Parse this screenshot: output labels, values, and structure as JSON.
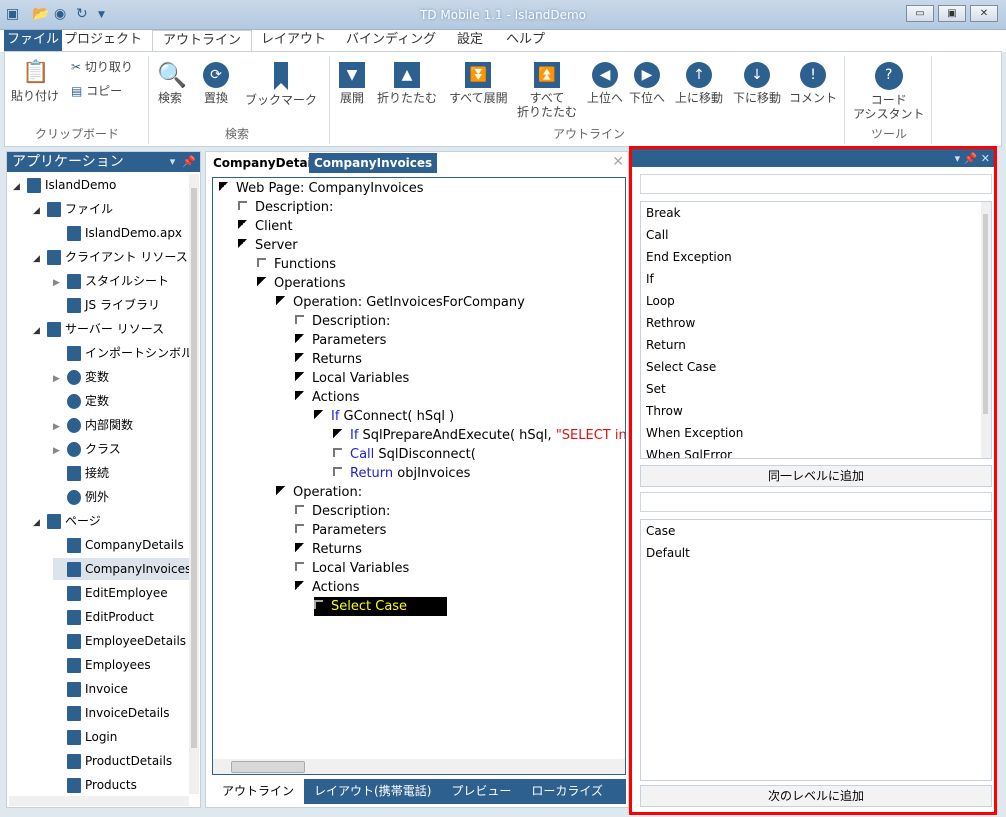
{
  "window": {
    "title": "TD Mobile 1.1 - IslandDemo",
    "minimize": "▭",
    "maximize": "▣",
    "close": "✕"
  },
  "menu_tabs": [
    "ファイル",
    "プロジェクト",
    "アウトライン",
    "レイアウト",
    "バインディング",
    "設定",
    "ヘルプ"
  ],
  "ribbon": {
    "clipboard": {
      "paste": "貼り付け",
      "cut": "切り取り",
      "copy": "コピー",
      "group": "クリップボード"
    },
    "search": {
      "find": "検索",
      "replace": "置換",
      "bookmark": "ブックマーク",
      "group": "検索"
    },
    "outline": {
      "buttons": [
        {
          "label": "展開",
          "icon": "▼"
        },
        {
          "label": "折りたたむ",
          "icon": "▲"
        },
        {
          "label": "すべて展開",
          "icon": "⏬"
        },
        {
          "label": "すべて\n折りたたむ",
          "icon": "⏫"
        },
        {
          "label": "上位へ",
          "icon": "◀"
        },
        {
          "label": "下位へ",
          "icon": "▶"
        },
        {
          "label": "上に移動",
          "icon": "↑"
        },
        {
          "label": "下に移動",
          "icon": "↓"
        },
        {
          "label": "コメント",
          "icon": "!"
        }
      ],
      "group": "アウトライン"
    },
    "tools": {
      "code_assistant": "コード\nアシスタント",
      "group": "ツール"
    }
  },
  "left_panel": {
    "title": "アプリケーション",
    "tree": [
      {
        "label": "IslandDemo",
        "level": 0,
        "exp": "open",
        "icon": "app"
      },
      {
        "label": "ファイル",
        "level": 1,
        "exp": "open",
        "icon": "files"
      },
      {
        "label": "IslandDemo.apx",
        "level": 2,
        "exp": "none",
        "icon": "apx"
      },
      {
        "label": "クライアント リソース",
        "level": 1,
        "exp": "open",
        "icon": "phone"
      },
      {
        "label": "スタイルシート",
        "level": 2,
        "exp": "closed",
        "icon": "css"
      },
      {
        "label": "JS ライブラリ",
        "level": 2,
        "exp": "none",
        "icon": "js"
      },
      {
        "label": "サーバー リソース",
        "level": 1,
        "exp": "open",
        "icon": "server"
      },
      {
        "label": "インポートシンボル",
        "level": 2,
        "exp": "none",
        "icon": "axl"
      },
      {
        "label": "変数",
        "level": 2,
        "exp": "closed",
        "icon": "variable"
      },
      {
        "label": "定数",
        "level": 2,
        "exp": "none",
        "icon": "constant"
      },
      {
        "label": "内部関数",
        "level": 2,
        "exp": "closed",
        "icon": "function"
      },
      {
        "label": "クラス",
        "level": 2,
        "exp": "closed",
        "icon": "gear"
      },
      {
        "label": "接続",
        "level": 2,
        "exp": "none",
        "icon": "connection"
      },
      {
        "label": "例外",
        "level": 2,
        "exp": "none",
        "icon": "exception"
      },
      {
        "label": "ページ",
        "level": 1,
        "exp": "open",
        "icon": "pages"
      },
      {
        "label": "CompanyDetails",
        "level": 2,
        "exp": "none",
        "icon": "page"
      },
      {
        "label": "CompanyInvoices",
        "level": 2,
        "exp": "none",
        "icon": "page",
        "selected": true
      },
      {
        "label": "EditEmployee",
        "level": 2,
        "exp": "none",
        "icon": "page"
      },
      {
        "label": "EditProduct",
        "level": 2,
        "exp": "none",
        "icon": "page"
      },
      {
        "label": "EmployeeDetails",
        "level": 2,
        "exp": "none",
        "icon": "page"
      },
      {
        "label": "Employees",
        "level": 2,
        "exp": "none",
        "icon": "page"
      },
      {
        "label": "Invoice",
        "level": 2,
        "exp": "none",
        "icon": "page"
      },
      {
        "label": "InvoiceDetails",
        "level": 2,
        "exp": "none",
        "icon": "page"
      },
      {
        "label": "Login",
        "level": 2,
        "exp": "none",
        "icon": "page"
      },
      {
        "label": "ProductDetails",
        "level": 2,
        "exp": "none",
        "icon": "page"
      },
      {
        "label": "Products",
        "level": 2,
        "exp": "none",
        "icon": "page"
      }
    ]
  },
  "editor": {
    "tabs": [
      "CompanyDetails",
      "CompanyInvoices"
    ],
    "active_tab": 1,
    "outline": [
      {
        "level": 0,
        "mark": "filled",
        "parts": [
          [
            "Web Page: CompanyInvoices",
            ""
          ]
        ]
      },
      {
        "level": 1,
        "mark": "empty",
        "parts": [
          [
            "Description:",
            ""
          ]
        ]
      },
      {
        "level": 1,
        "mark": "filled",
        "parts": [
          [
            "Client",
            ""
          ]
        ]
      },
      {
        "level": 1,
        "mark": "filled",
        "parts": [
          [
            "Server",
            ""
          ]
        ]
      },
      {
        "level": 2,
        "mark": "empty",
        "parts": [
          [
            "Functions",
            ""
          ]
        ]
      },
      {
        "level": 2,
        "mark": "filled",
        "parts": [
          [
            "Operations",
            ""
          ]
        ]
      },
      {
        "level": 3,
        "mark": "filled",
        "parts": [
          [
            "Operation: GetInvoicesForCompany",
            ""
          ]
        ]
      },
      {
        "level": 4,
        "mark": "empty",
        "parts": [
          [
            "Description:",
            ""
          ]
        ]
      },
      {
        "level": 4,
        "mark": "filled",
        "parts": [
          [
            "Parameters",
            ""
          ]
        ]
      },
      {
        "level": 4,
        "mark": "filled",
        "parts": [
          [
            "Returns",
            ""
          ]
        ]
      },
      {
        "level": 4,
        "mark": "filled",
        "parts": [
          [
            "Local Variables",
            ""
          ]
        ]
      },
      {
        "level": 4,
        "mark": "filled",
        "parts": [
          [
            "Actions",
            ""
          ]
        ]
      },
      {
        "level": 5,
        "mark": "filled",
        "parts": [
          [
            "If ",
            "kw"
          ],
          [
            "GConnect( hSql )",
            ""
          ]
        ]
      },
      {
        "level": 6,
        "mark": "filled",
        "parts": [
          [
            "If ",
            "kw"
          ],
          [
            "SqlPrepareAndExecute( hSql, ",
            ""
          ],
          [
            "\"SELECT invoi",
            "str"
          ]
        ]
      },
      {
        "level": 6,
        "mark": "empty",
        "parts": [
          [
            "Call ",
            "kw"
          ],
          [
            "SqlDisconnect(",
            ""
          ]
        ]
      },
      {
        "level": 6,
        "mark": "empty",
        "parts": [
          [
            "Return ",
            "kw"
          ],
          [
            "objInvoices",
            ""
          ]
        ]
      },
      {
        "level": 3,
        "mark": "filled",
        "parts": [
          [
            "Operation:",
            ""
          ]
        ]
      },
      {
        "level": 4,
        "mark": "empty",
        "parts": [
          [
            "Description:",
            ""
          ]
        ]
      },
      {
        "level": 4,
        "mark": "empty",
        "parts": [
          [
            "Parameters",
            ""
          ]
        ]
      },
      {
        "level": 4,
        "mark": "filled",
        "parts": [
          [
            "Returns",
            ""
          ]
        ]
      },
      {
        "level": 4,
        "mark": "empty",
        "parts": [
          [
            "Local Variables",
            ""
          ]
        ]
      },
      {
        "level": 4,
        "mark": "filled",
        "parts": [
          [
            "Actions",
            ""
          ]
        ]
      },
      {
        "level": 5,
        "mark": "empty",
        "parts": [
          [
            "Select Case",
            ""
          ]
        ],
        "highlighted": true
      }
    ],
    "bottom_tabs": [
      "アウトライン",
      "レイアウト(携帯電話)",
      "プレビュー",
      "ローカライズ"
    ],
    "active_bottom_tab": 0
  },
  "right_panel": {
    "search_value": "",
    "same_level_items": [
      "Break",
      "Call",
      "End Exception",
      "If",
      "Loop",
      "Rethrow",
      "Return",
      "Select Case",
      "Set",
      "Throw",
      "When Exception",
      "When SqlError"
    ],
    "add_same_level": "同一レベルに追加",
    "filter_value": "",
    "next_level_items": [
      "Case",
      "Default"
    ],
    "add_next_level": "次のレベルに追加"
  },
  "colors": {
    "accent": "#2d5f8f",
    "highlight_border": "#ff0000",
    "keyword": "#2020d0",
    "string": "#e01010"
  }
}
